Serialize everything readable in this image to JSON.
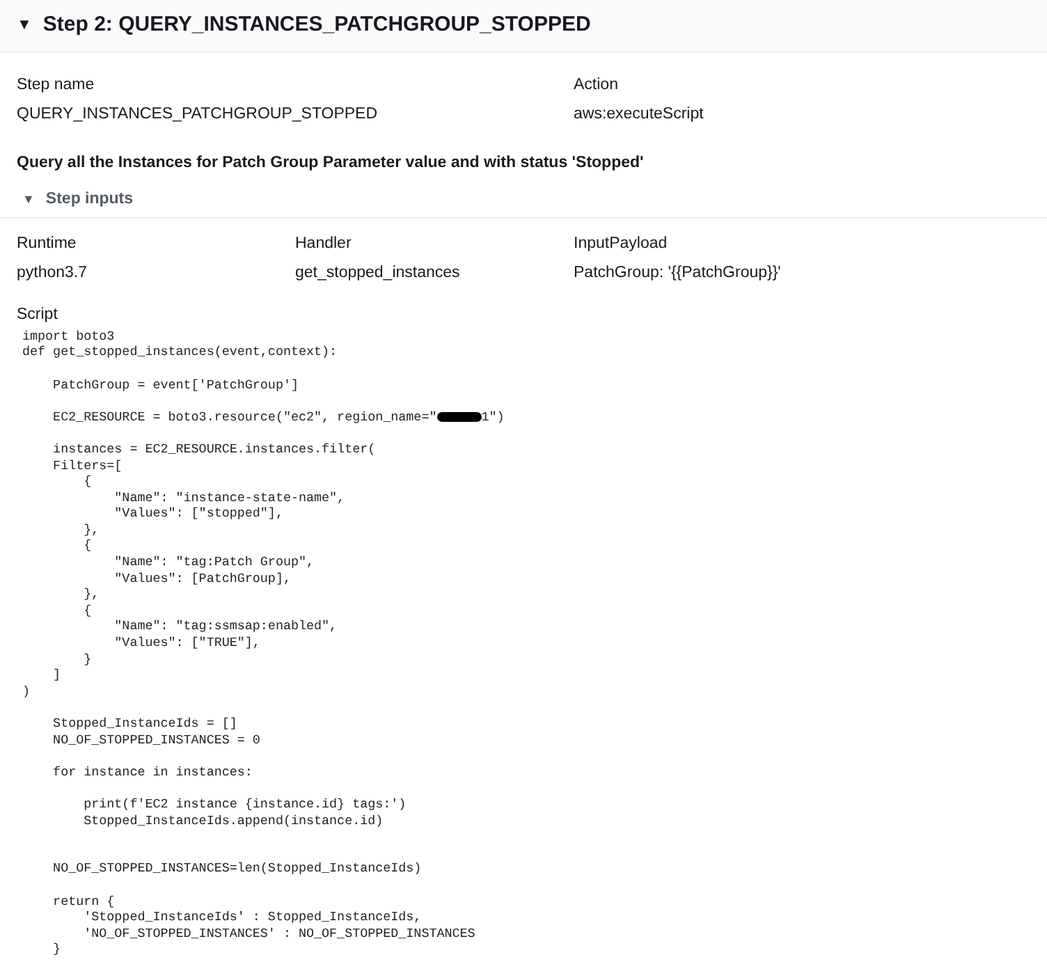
{
  "header": {
    "caret": "▼",
    "title": "Step 2: QUERY_INSTANCES_PATCHGROUP_STOPPED",
    "expanded": true
  },
  "details": [
    {
      "label": "Step name",
      "value": "QUERY_INSTANCES_PATCHGROUP_STOPPED"
    },
    {
      "label": "Action",
      "value": "aws:executeScript"
    }
  ],
  "description": "Query all the Instances for Patch Group Parameter value and with status 'Stopped'",
  "step_inputs": {
    "caret": "▼",
    "title": "Step inputs",
    "expanded": true,
    "fields": [
      {
        "label": "Runtime",
        "value": "python3.7"
      },
      {
        "label": "Handler",
        "value": "get_stopped_instances"
      },
      {
        "label": "InputPayload",
        "value": "PatchGroup: '{{PatchGroup}}'"
      }
    ]
  },
  "script": {
    "label": "Script",
    "lines": [
      {
        "kind": "code",
        "text": "import boto3"
      },
      {
        "kind": "code",
        "text": "def get_stopped_instances(event,context):"
      },
      {
        "kind": "blank"
      },
      {
        "kind": "code",
        "text": "    PatchGroup = event['PatchGroup']"
      },
      {
        "kind": "blank"
      },
      {
        "kind": "redacted",
        "text": "    EC2_RESOURCE = boto3.resource(\"ec2\", region_name=\"",
        "after": "1\")"
      },
      {
        "kind": "blank"
      },
      {
        "kind": "code",
        "text": "    instances = EC2_RESOURCE.instances.filter("
      },
      {
        "kind": "code",
        "text": "    Filters=["
      },
      {
        "kind": "code",
        "text": "        {"
      },
      {
        "kind": "code",
        "text": "            \"Name\": \"instance-state-name\","
      },
      {
        "kind": "code",
        "text": "            \"Values\": [\"stopped\"],"
      },
      {
        "kind": "code",
        "text": "        },"
      },
      {
        "kind": "code",
        "text": "        {"
      },
      {
        "kind": "code",
        "text": "            \"Name\": \"tag:Patch Group\","
      },
      {
        "kind": "code",
        "text": "            \"Values\": [PatchGroup],"
      },
      {
        "kind": "code",
        "text": "        },"
      },
      {
        "kind": "code",
        "text": "        {"
      },
      {
        "kind": "code",
        "text": "            \"Name\": \"tag:ssmsap:enabled\","
      },
      {
        "kind": "code",
        "text": "            \"Values\": [\"TRUE\"],"
      },
      {
        "kind": "code",
        "text": "        }"
      },
      {
        "kind": "code",
        "text": "    ]"
      },
      {
        "kind": "code",
        "text": ")"
      },
      {
        "kind": "blank"
      },
      {
        "kind": "code",
        "text": "    Stopped_InstanceIds = []"
      },
      {
        "kind": "code",
        "text": "    NO_OF_STOPPED_INSTANCES = 0"
      },
      {
        "kind": "blank"
      },
      {
        "kind": "code",
        "text": "    for instance in instances:"
      },
      {
        "kind": "blank"
      },
      {
        "kind": "code",
        "text": "        print(f'EC2 instance {instance.id} tags:')"
      },
      {
        "kind": "code",
        "text": "        Stopped_InstanceIds.append(instance.id)"
      },
      {
        "kind": "blank"
      },
      {
        "kind": "blank"
      },
      {
        "kind": "code",
        "text": "    NO_OF_STOPPED_INSTANCES=len(Stopped_InstanceIds)"
      },
      {
        "kind": "blank"
      },
      {
        "kind": "code",
        "text": "    return {"
      },
      {
        "kind": "code",
        "text": "        'Stopped_InstanceIds' : Stopped_InstanceIds,"
      },
      {
        "kind": "code",
        "text": "        'NO_OF_STOPPED_INSTANCES' : NO_OF_STOPPED_INSTANCES"
      },
      {
        "kind": "code",
        "text": "    }"
      }
    ]
  }
}
